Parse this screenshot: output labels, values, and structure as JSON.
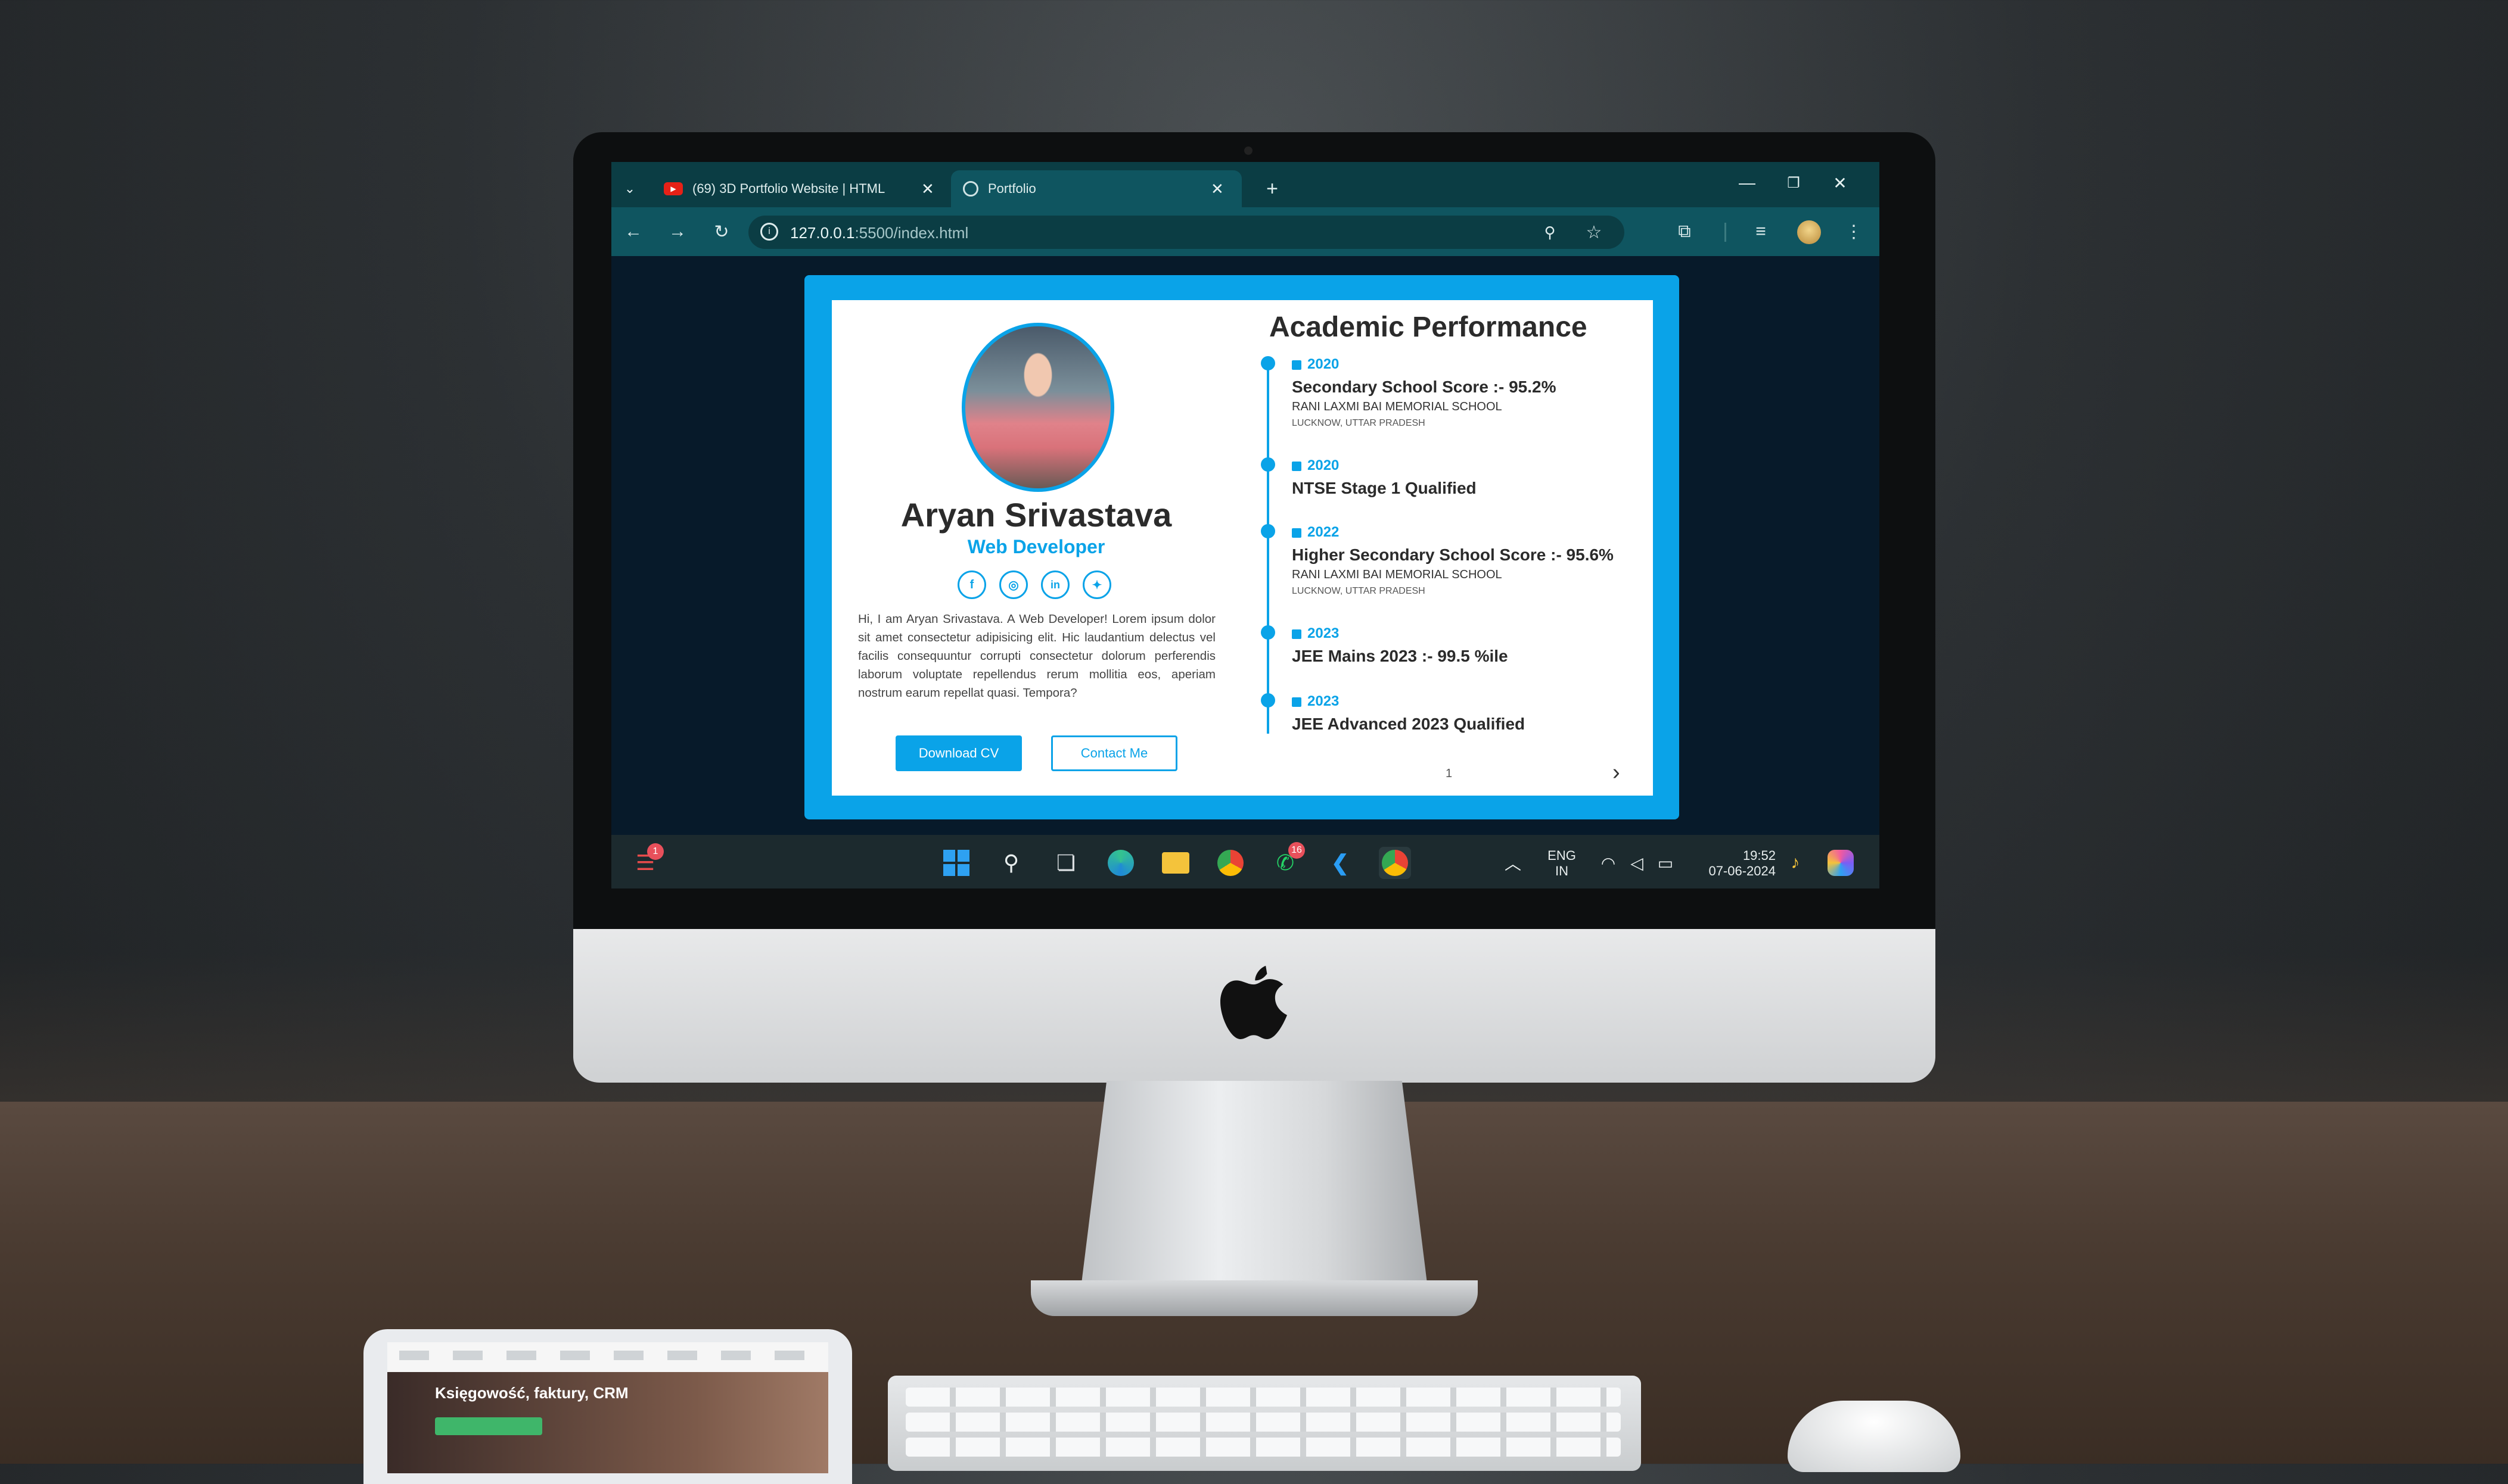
{
  "browser": {
    "tabs": [
      {
        "title": "(69) 3D Portfolio Website | HTML",
        "active": false,
        "icon": "youtube-icon"
      },
      {
        "title": "Portfolio",
        "active": true,
        "icon": "globe-icon"
      }
    ],
    "new_tab": "+",
    "url_host": "127.0.0.1",
    "url_path": ":5500/index.html"
  },
  "profile": {
    "name": "Aryan Srivastava",
    "role": "Web Developer",
    "social": [
      {
        "label": "f",
        "icon": "facebook-icon"
      },
      {
        "label": "◎",
        "icon": "instagram-icon"
      },
      {
        "label": "in",
        "icon": "linkedin-icon"
      },
      {
        "label": "✦",
        "icon": "twitter-icon"
      }
    ],
    "bio": "Hi, I am Aryan Srivastava. A Web Developer! Lorem ipsum dolor sit amet consectetur adipisicing elit. Hic laudantium delectus vel facilis consequuntur corrupti consectetur dolorum perferendis laborum voluptate repellendus rerum mollitia eos, aperiam nostrum earum repellat quasi. Tempora?",
    "download_cv": "Download CV",
    "contact_me": "Contact Me"
  },
  "academics": {
    "title": "Academic Performance",
    "items": [
      {
        "year": "2020",
        "heading": "Secondary School Score :- 95.2%",
        "school": "RANI LAXMI BAI MEMORIAL SCHOOL",
        "location": "LUCKNOW, UTTAR PRADESH"
      },
      {
        "year": "2020",
        "heading": "NTSE Stage 1 Qualified"
      },
      {
        "year": "2022",
        "heading": "Higher Secondary School Score :- 95.6%",
        "school": "RANI LAXMI BAI MEMORIAL SCHOOL",
        "location": "LUCKNOW, UTTAR PRADESH"
      },
      {
        "year": "2023",
        "heading": "JEE Mains 2023 :- 99.5 %ile"
      },
      {
        "year": "2023",
        "heading": "JEE Advanced 2023 Qualified"
      }
    ],
    "page_number": "1",
    "next": "›"
  },
  "taskbar": {
    "widget_badge": "1",
    "whatsapp_badge": "16",
    "lang_top": "ENG",
    "lang_bottom": "IN",
    "time": "19:52",
    "date": "07-06-2024"
  },
  "tablet": {
    "headline": "Księgowość, faktury, CRM"
  },
  "colors": {
    "accent": "#0aa3e8",
    "tabbar": "#0b3d44",
    "toolbar": "#0f5560"
  }
}
